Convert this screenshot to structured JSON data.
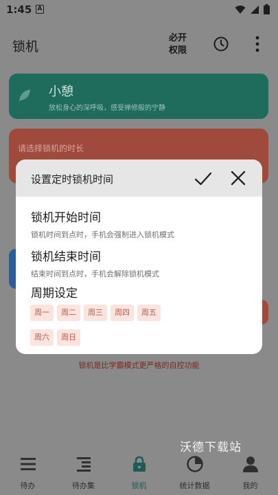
{
  "status_bar": {
    "time": "1:45",
    "notif_badge": "A"
  },
  "app_bar": {
    "title": "锁机",
    "permission_line1": "必开",
    "permission_line2": "权限"
  },
  "cards": {
    "xiaoqi": {
      "name": "小憩",
      "desc": "放松身心的深呼吸，感受禅修般的宁静",
      "color": "#1f6b5c"
    },
    "duration": {
      "label": "请选择锁机的时长",
      "color": "#a04a3e"
    },
    "blue_color": "#2a5e9a"
  },
  "footer_note": "锁机是比学霸模式更严格的自控功能",
  "watermark": "沃德下载站",
  "dialog": {
    "title": "设置定时锁机时间",
    "confirm_icon": "check-icon",
    "close_icon": "close-icon",
    "start": {
      "title": "锁机开始时间",
      "desc": "锁机时间到点时，手机会强制进入锁机模式"
    },
    "end": {
      "title": "锁机结束时间",
      "desc": "结束时间到点时，手机会解除锁机模式"
    },
    "period": {
      "title": "周期设定",
      "days": [
        "周一",
        "周二",
        "周三",
        "周四",
        "周五",
        "周六",
        "周日"
      ]
    }
  },
  "bottom_nav": [
    {
      "label": "待办",
      "icon": "list-icon"
    },
    {
      "label": "待办集",
      "icon": "list-collection-icon"
    },
    {
      "label": "锁机",
      "icon": "lock-icon",
      "active": true
    },
    {
      "label": "统计数据",
      "icon": "pie-chart-icon"
    },
    {
      "label": "我的",
      "icon": "person-icon"
    }
  ]
}
